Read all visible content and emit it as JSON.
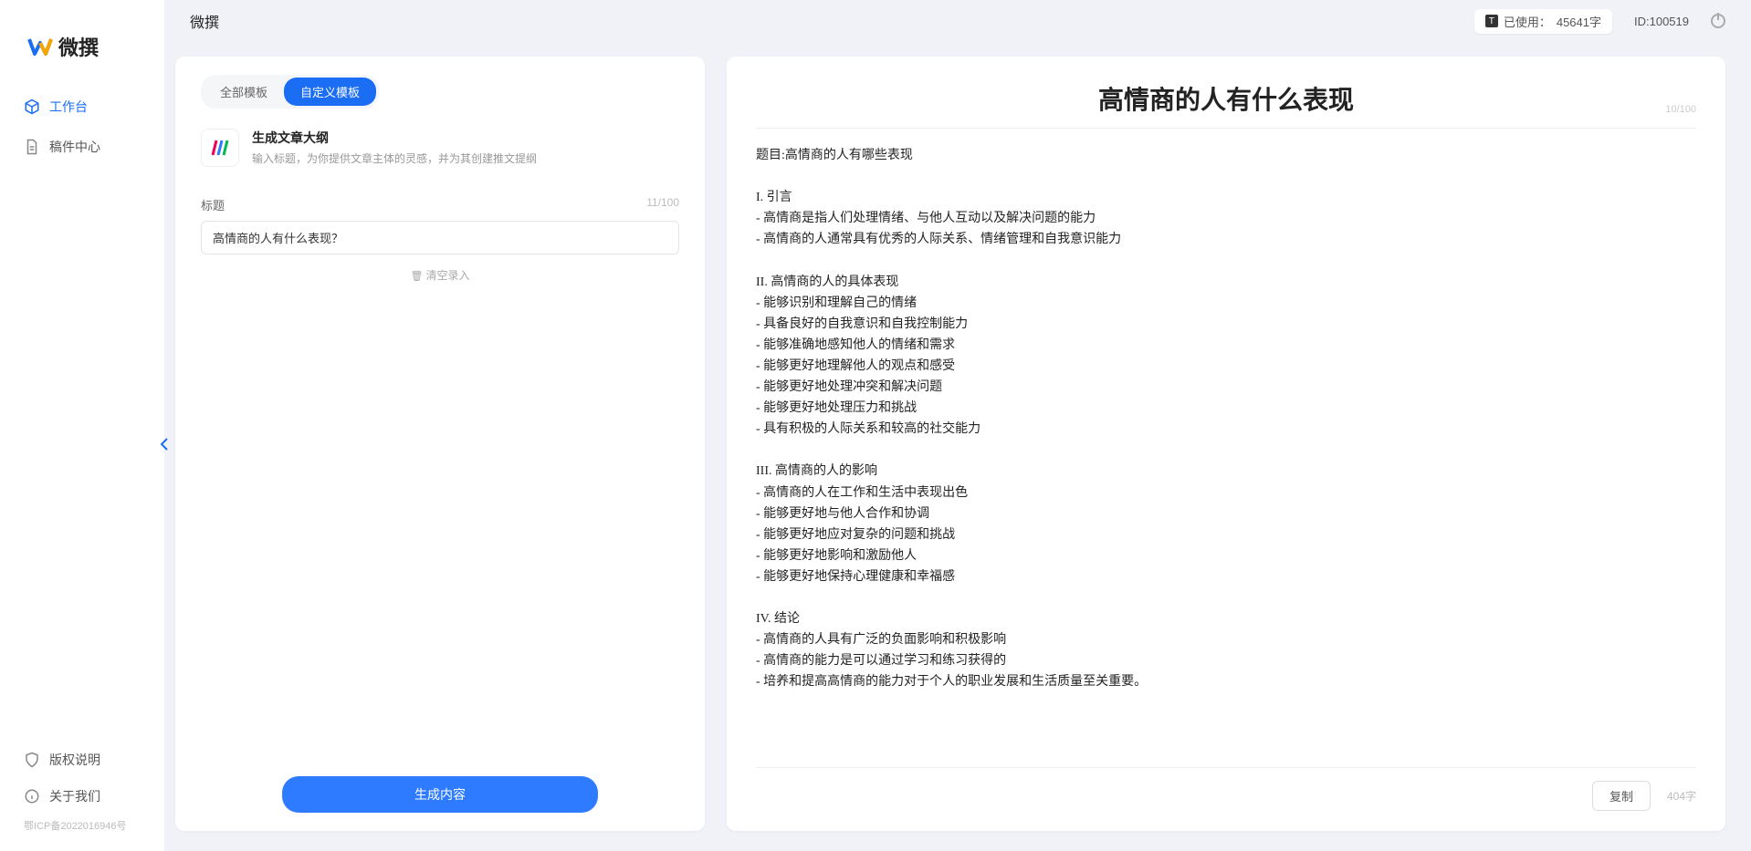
{
  "brand": {
    "name": "微撰"
  },
  "topbar": {
    "title": "微撰",
    "usage_label": "已使用：",
    "usage_value": "45641字",
    "id_label": "ID:100519"
  },
  "sidebar": {
    "items": [
      {
        "label": "工作台",
        "icon": "cube-icon",
        "active": true
      },
      {
        "label": "稿件中心",
        "icon": "doc-icon",
        "active": false
      }
    ],
    "bottom": [
      {
        "label": "版权说明",
        "icon": "shield-icon"
      },
      {
        "label": "关于我们",
        "icon": "info-icon"
      }
    ],
    "icp": "鄂ICP备2022016946号"
  },
  "left": {
    "tabs": [
      {
        "label": "全部模板",
        "active": false
      },
      {
        "label": "自定义模板",
        "active": true
      }
    ],
    "template": {
      "title": "生成文章大纲",
      "desc": "输入标题，为你提供文章主体的灵感，并为其创建推文提纲"
    },
    "field_label": "标题",
    "field_count": "11/100",
    "field_value": "高情商的人有什么表现？",
    "clear_label": "清空录入",
    "generate_label": "生成内容"
  },
  "doc": {
    "title": "高情商的人有什么表现",
    "title_count": "10/100",
    "body": "题目:高情商的人有哪些表现\n\nI. 引言\n- 高情商是指人们处理情绪、与他人互动以及解决问题的能力\n- 高情商的人通常具有优秀的人际关系、情绪管理和自我意识能力\n\nII. 高情商的人的具体表现\n- 能够识别和理解自己的情绪\n- 具备良好的自我意识和自我控制能力\n- 能够准确地感知他人的情绪和需求\n- 能够更好地理解他人的观点和感受\n- 能够更好地处理冲突和解决问题\n- 能够更好地处理压力和挑战\n- 具有积极的人际关系和较高的社交能力\n\nIII. 高情商的人的影响\n- 高情商的人在工作和生活中表现出色\n- 能够更好地与他人合作和协调\n- 能够更好地应对复杂的问题和挑战\n- 能够更好地影响和激励他人\n- 能够更好地保持心理健康和幸福感\n\nIV. 结论\n- 高情商的人具有广泛的负面影响和积极影响\n- 高情商的能力是可以通过学习和练习获得的\n- 培养和提高高情商的能力对于个人的职业发展和生活质量至关重要。",
    "copy_label": "复制",
    "word_count": "404字"
  }
}
